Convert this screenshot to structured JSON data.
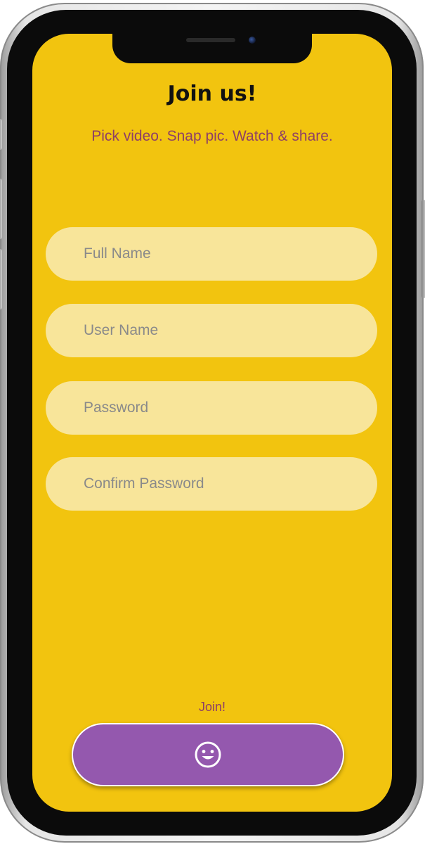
{
  "header": {
    "title": "Join us!",
    "subtitle": "Pick video. Snap pic. Watch & share."
  },
  "form": {
    "full_name_placeholder": "Full Name",
    "user_name_placeholder": "User Name",
    "password_placeholder": "Password",
    "confirm_password_placeholder": "Confirm Password"
  },
  "footer": {
    "join_label": "Join!",
    "join_button_icon": "smiley-face-icon"
  },
  "colors": {
    "background": "#f2c40f",
    "field_background": "#f8e59a",
    "subtitle_text": "#8e3f66",
    "button": "#9458ae"
  }
}
